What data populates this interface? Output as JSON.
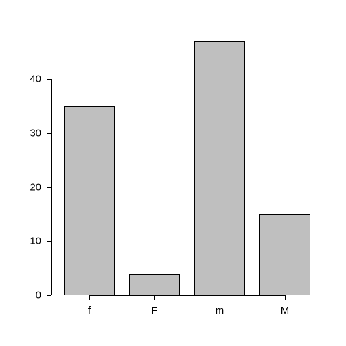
{
  "chart_data": {
    "type": "bar",
    "categories": [
      "f",
      "F",
      "m",
      "M"
    ],
    "values": [
      35,
      4,
      47,
      15
    ],
    "title": "",
    "xlabel": "",
    "ylabel": "",
    "ylim": [
      0,
      47
    ],
    "yticks": [
      0,
      10,
      20,
      30,
      40
    ]
  },
  "bar_fill": "#bfbfbf"
}
